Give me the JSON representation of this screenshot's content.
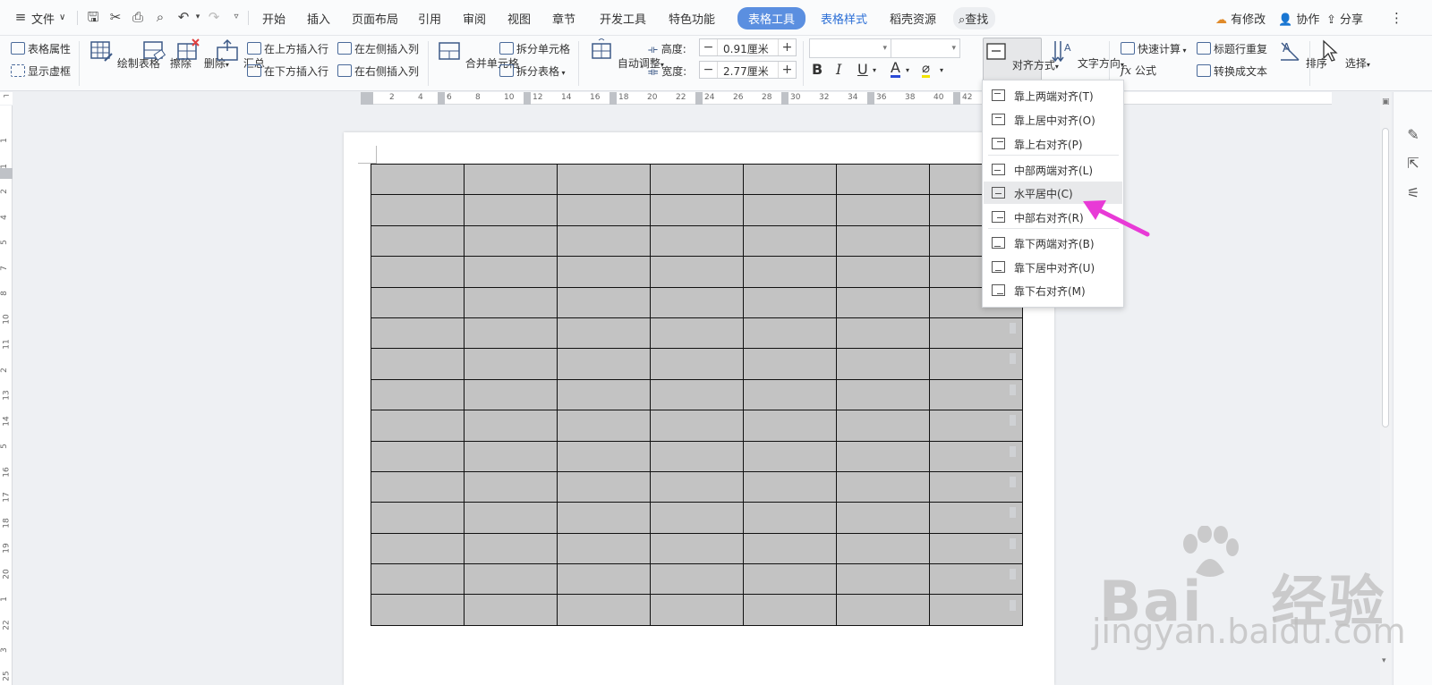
{
  "menubar": {
    "file_label": "文件",
    "tabs": [
      "开始",
      "插入",
      "页面布局",
      "引用",
      "审阅",
      "视图",
      "章节",
      "开发工具",
      "特色功能"
    ],
    "active_tab": "表格工具",
    "blue_tab": "表格样式",
    "extra_tab": "稻壳资源",
    "search_label": "查找",
    "right": {
      "changes": "有修改",
      "collab": "协作",
      "share": "分享"
    }
  },
  "ribbon": {
    "table_props": "表格属性",
    "show_gridlines": "显示虚框",
    "draw_table": "绘制表格",
    "erase": "擦除",
    "delete": "删除",
    "summary": "汇总",
    "insert_above": "在上方插入行",
    "insert_below": "在下方插入行",
    "insert_left": "在左侧插入列",
    "insert_right": "在右侧插入列",
    "merge_cells": "合并单元格",
    "split_cells": "拆分单元格",
    "split_table": "拆分表格",
    "auto_fit": "自动调整",
    "height_label": "高度:",
    "height_value": "0.91厘米",
    "width_label": "宽度:",
    "width_value": "2.77厘米",
    "bold": "B",
    "italic": "I",
    "underline": "U",
    "font_color": "A",
    "align": "对齐方式",
    "text_direction": "文字方向",
    "quick_calc": "快速计算",
    "formula": "公式",
    "repeat_header": "标题行重复",
    "to_text": "转换成文本",
    "sort": "排序",
    "select": "选择"
  },
  "ruler": {
    "h_numbers": [
      "2",
      "4",
      "6",
      "8",
      "10",
      "12",
      "14",
      "16",
      "18",
      "20",
      "22",
      "24",
      "26",
      "28",
      "30",
      "32",
      "34",
      "36",
      "38",
      "40",
      "42"
    ],
    "v_numbers": [
      "1",
      "1",
      "2",
      "4",
      "5",
      "7",
      "8",
      "10",
      "11",
      "2",
      "13",
      "14",
      "5",
      "16",
      "17",
      "18",
      "19",
      "20",
      "1",
      "22",
      "3",
      "25"
    ]
  },
  "dropdown": {
    "items": [
      {
        "label": "靠上两端对齐(T)"
      },
      {
        "label": "靠上居中对齐(O)"
      },
      {
        "label": "靠上右对齐(P)"
      },
      {
        "label": "中部两端对齐(L)"
      },
      {
        "label": "水平居中(C)"
      },
      {
        "label": "中部右对齐(R)"
      },
      {
        "label": "靠下两端对齐(B)"
      },
      {
        "label": "靠下居中对齐(U)"
      },
      {
        "label": "靠下右对齐(M)"
      }
    ],
    "highlighted_index": 4
  },
  "table": {
    "rows": 15,
    "cols": 7
  },
  "watermark": {
    "brand": "Bai",
    "cn": "经验",
    "url": "jingyan.baidu.com"
  },
  "colors": {
    "accent": "#5b8fe0",
    "arrow": "#e83ad6",
    "cell": "#c3c3c3"
  }
}
